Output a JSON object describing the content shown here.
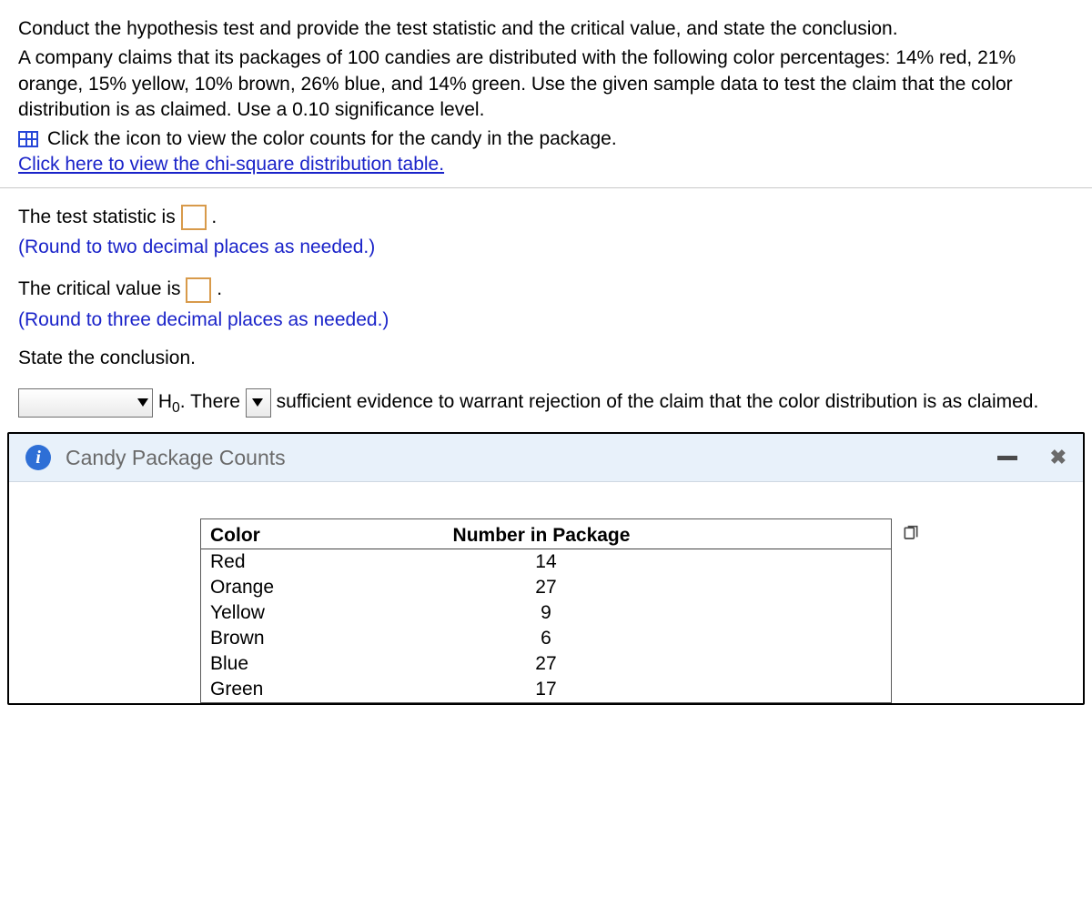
{
  "intro": {
    "line1": "Conduct the hypothesis test and provide the test statistic and the critical value, and state the conclusion.",
    "line2": "A company claims that its packages of 100 candies are distributed with the following color percentages: 14% red, 21% orange, 15% yellow, 10% brown, 26% blue, and 14% green. Use the given sample data to test the claim that the color distribution is as claimed. Use a 0.10 significance level.",
    "icon_line": "Click the icon to view the color counts for the candy in the package.",
    "chi_link": "Click here to view the chi-square distribution table."
  },
  "q": {
    "test_stat_pre": "The test statistic is ",
    "test_stat_post": ".",
    "test_stat_hint": "(Round to two decimal places as needed.)",
    "crit_pre": "The critical value is ",
    "crit_post": ".",
    "crit_hint": "(Round to three decimal places as needed.)",
    "state": "State the conclusion.",
    "concl_mid1": " H",
    "concl_mid1b": ". There ",
    "concl_mid2": " sufficient evidence to warrant rejection of the claim that the color distribution is as claimed."
  },
  "popup": {
    "title": "Candy Package Counts",
    "headers": {
      "c1": "Color",
      "c2": "Number in Package"
    },
    "rows": [
      {
        "color": "Red",
        "n": "14"
      },
      {
        "color": "Orange",
        "n": "27"
      },
      {
        "color": "Yellow",
        "n": "9"
      },
      {
        "color": "Brown",
        "n": "6"
      },
      {
        "color": "Blue",
        "n": "27"
      },
      {
        "color": "Green",
        "n": "17"
      }
    ]
  },
  "chart_data": {
    "type": "table",
    "title": "Candy Package Counts",
    "columns": [
      "Color",
      "Number in Package"
    ],
    "rows": [
      [
        "Red",
        14
      ],
      [
        "Orange",
        27
      ],
      [
        "Yellow",
        9
      ],
      [
        "Brown",
        6
      ],
      [
        "Blue",
        27
      ],
      [
        "Green",
        17
      ]
    ],
    "claimed_percentages": {
      "Red": 14,
      "Orange": 21,
      "Yellow": 15,
      "Brown": 10,
      "Blue": 26,
      "Green": 14
    },
    "significance_level": 0.1
  }
}
